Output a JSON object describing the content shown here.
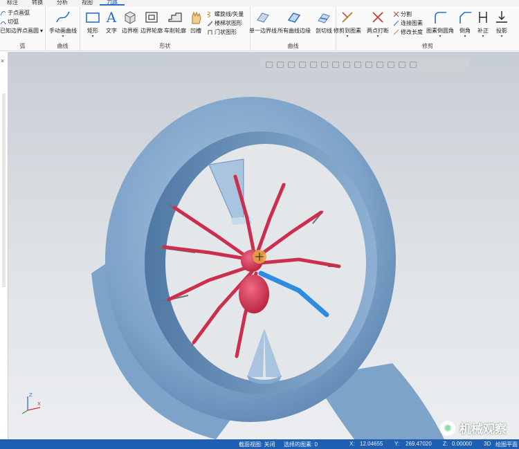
{
  "tabs": [
    {
      "label": "标注",
      "active": false
    },
    {
      "label": "转换",
      "active": false
    },
    {
      "label": "分析",
      "active": false
    },
    {
      "label": "视图",
      "active": false
    },
    {
      "label": "刀路",
      "active": true
    }
  ],
  "ribbon": {
    "group0": {
      "items": [
        "于点画弧",
        "切弧",
        "已知边界点画圆"
      ],
      "label": "弧"
    },
    "group_curve": {
      "btn_label": "手动画曲线",
      "label": "曲线"
    },
    "group_shape": {
      "buttons": [
        "矩形",
        "文字",
        "边界框",
        "边界轮廓",
        "车削轮廓",
        "凹槽"
      ],
      "small": [
        "螺旋线/矢量",
        "楼梯状图形",
        "门状图形"
      ],
      "label": "形状"
    },
    "group_curve2": {
      "buttons": [
        "单一边界线",
        "所有曲线边缘",
        "剖切线"
      ],
      "label": "曲线"
    },
    "group_modify": {
      "buttons": [
        "修剪到图素",
        "两点打断"
      ],
      "small": [
        "分割",
        "连接图素",
        "修改长度"
      ],
      "buttons2": [
        "图素倒圆角",
        "倒角",
        "补正",
        "投影"
      ],
      "label": "修剪"
    }
  },
  "statusbar": {
    "section_view": "截面视图: 关闭",
    "selected": "选择的图素: 0",
    "x_label": "X:",
    "x_value": "12.04655",
    "y_label": "Y:",
    "y_value": "269.47020",
    "z_label": "Z:",
    "z_value": "0.00000",
    "mode": "3D",
    "plane": "绘图平面"
  },
  "watermark": "机械观察",
  "colors": {
    "statusbar": "#1f5fb3",
    "ring": "#7ea3c9",
    "spider": "#cc2f4e",
    "highlight": "#2f8be0"
  }
}
